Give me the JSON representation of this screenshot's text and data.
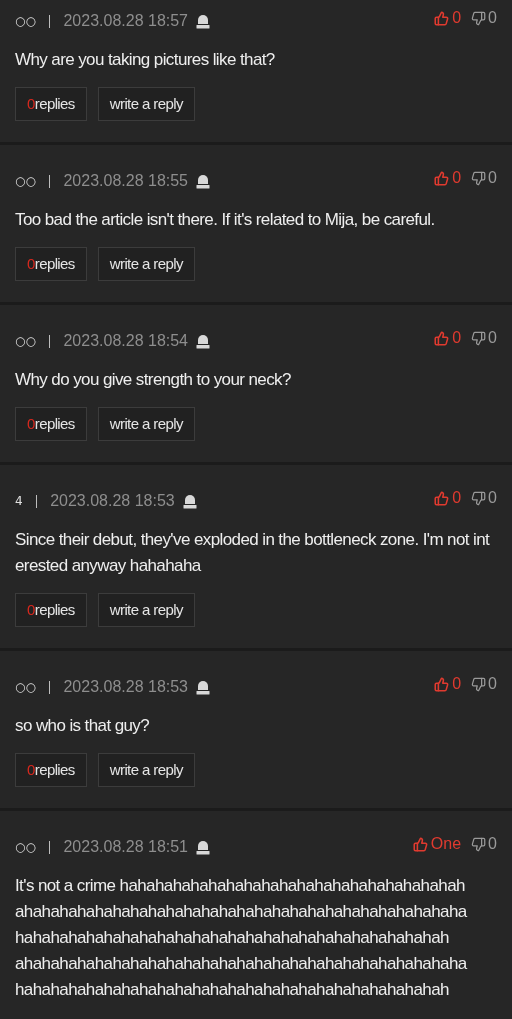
{
  "comments": [
    {
      "author": "○○",
      "date": "2023.08.28 18:57",
      "likes": "0",
      "dislikes": "0",
      "body": [
        "Why are you taking pictures like that?"
      ],
      "reply_count": "0",
      "replies_label": "replies",
      "write_label": "write a reply"
    },
    {
      "author": "○○",
      "date": "2023.08.28 18:55",
      "likes": "0",
      "dislikes": "0",
      "body": [
        "Too bad the article isn't there. If it's related to Mija, be careful."
      ],
      "reply_count": "0",
      "replies_label": "replies",
      "write_label": "write a reply"
    },
    {
      "author": "○○",
      "date": "2023.08.28 18:54",
      "likes": "0",
      "dislikes": "0",
      "body": [
        "Why do you give strength to your neck?"
      ],
      "reply_count": "0",
      "replies_label": "replies",
      "write_label": "write a reply"
    },
    {
      "author": "4",
      "date": "2023.08.28 18:53",
      "likes": "0",
      "dislikes": "0",
      "body": [
        "Since their debut, they've exploded in the bottleneck zone. I'm not int",
        "erested anyway hahahaha"
      ],
      "reply_count": "0",
      "replies_label": "replies",
      "write_label": "write a reply"
    },
    {
      "author": "○○",
      "date": "2023.08.28 18:53",
      "likes": "0",
      "dislikes": "0",
      "body": [
        "so who is that guy?"
      ],
      "reply_count": "0",
      "replies_label": "replies",
      "write_label": "write a reply"
    },
    {
      "author": "○○",
      "date": "2023.08.28 18:51",
      "likes": "One",
      "dislikes": "0",
      "body": [
        "It's not a crime hahahahahahahahahahahahahahahahahahahah",
        "ahahahahahahahahahahahahahahahahahahahahahahahahaha",
        "hahahahahahahahahahahahahahahahahahahahahahahahah",
        "ahahahahahahahahahahahahahahahahahahahahahahahahaha",
        "hahahahahahahahahahahahahahahahahahahahahahahahah"
      ]
    }
  ]
}
